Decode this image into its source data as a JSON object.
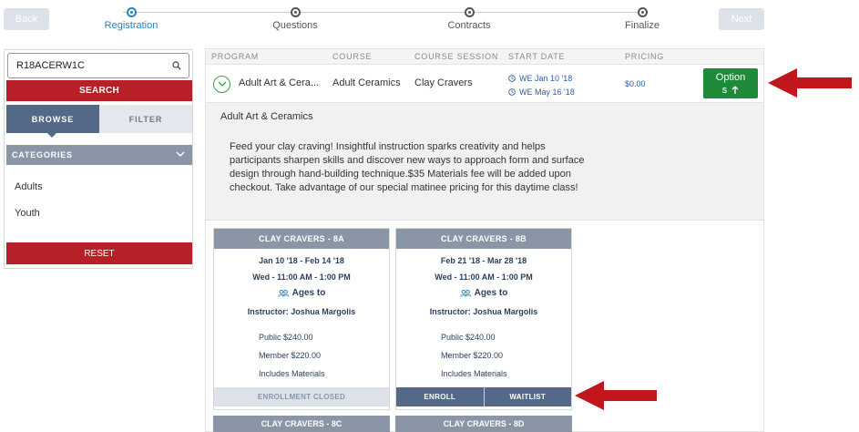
{
  "nav": {
    "back_label": "Back",
    "next_label": "Next",
    "steps": [
      {
        "label": "Registration",
        "active": true
      },
      {
        "label": "Questions",
        "active": false
      },
      {
        "label": "Contracts",
        "active": false
      },
      {
        "label": "Finalize",
        "active": false
      }
    ]
  },
  "sidebar": {
    "search_value": "R18ACERW1C",
    "search_button": "SEARCH",
    "tab_browse": "BROWSE",
    "tab_filter": "FILTER",
    "categories_label": "CATEGORIES",
    "categories": [
      "Adults",
      "Youth"
    ],
    "reset_button": "RESET"
  },
  "table": {
    "headers": [
      "PROGRAM",
      "COURSE",
      "COURSE SESSION",
      "START DATE",
      "PRICING"
    ],
    "row": {
      "program": "Adult Art & Cera...",
      "course": "Adult Ceramics",
      "session": "Clay Cravers",
      "date_start": "WE Jan 10 '18",
      "date_end": "WE May 16 '18",
      "price": "$0.00",
      "options_line1": "Option",
      "options_line2": "s"
    }
  },
  "description": {
    "title": "Adult Art & Ceramics",
    "lines": [
      "Feed your clay craving! Insightful instruction sparks creativity and helps",
      "participants sharpen skills and discover new ways to approach form and surface",
      "design through hand-building technique.$35 Materials fee will be added upon",
      "checkout. Take advantage of our special matinee pricing for this daytime class!"
    ]
  },
  "sessions": [
    {
      "name": "CLAY CRAVERS - 8A",
      "dates": "Jan 10 '18 - Feb 14 '18",
      "time": "Wed - 11:00 AM - 1:00 PM",
      "ages": "Ages to",
      "instructor": "Instructor: Joshua Margolis",
      "public": "Public $240.00",
      "member": "Member $220.00",
      "materials": "Includes Materials",
      "status": "ENROLLMENT CLOSED"
    },
    {
      "name": "CLAY CRAVERS - 8B",
      "dates": "Feb 21 '18 - Mar 28 '18",
      "time": "Wed - 11:00 AM - 1:00 PM",
      "ages": "Ages to",
      "instructor": "Instructor: Joshua Margolis",
      "public": "Public $240.00",
      "member": "Member $220.00",
      "materials": "Includes Materials",
      "enroll": "ENROLL",
      "waitlist": "WAITLIST"
    }
  ],
  "next_sessions": [
    "CLAY CRAVERS - 8C",
    "CLAY CRAVERS - 8D"
  ],
  "colors": {
    "accent_blue": "#2b83c5",
    "search_red": "#b72027",
    "options_green": "#1f8a3a",
    "arrow_red": "#c0161c",
    "slate": "#536987"
  },
  "icons": [
    "search-icon",
    "chevron-down-icon",
    "chevron-circle-icon",
    "clock-icon",
    "group-icon",
    "arrow-up-icon",
    "red-arrow-icon"
  ]
}
